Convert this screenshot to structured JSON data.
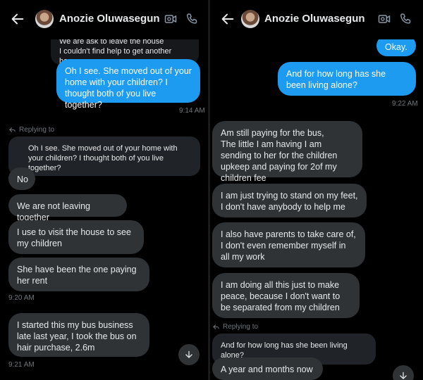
{
  "left": {
    "header": {
      "name": "Anozie Oluwasegun"
    },
    "quoted_top": "We are ask to leave the house\nI couldn't find help to get another house,...",
    "msg_blue": "Oh I see. She moved out of your home with your children? I thought both of you live together?",
    "time1": "9:14 AM",
    "replying_to": "Replying to",
    "quoted_reply": "Oh I see. She moved out of your home with your children? I thought both of you live together?",
    "msg_no": "No",
    "msg_not_leaving": "We are not leaving together",
    "msg_visit": "I use to visit the house to see my children",
    "msg_paying": "She have been the one paying her rent",
    "time2": "9:20 AM",
    "msg_bus": "I started this my bus business late last year, I took the bus on hair purchase, 2.6m",
    "time3": "9:21 AM"
  },
  "right": {
    "header": {
      "name": "Anozie Oluwasegun"
    },
    "msg_okay": "Okay.",
    "msg_how_long": "And for how long has she been living alone?",
    "time1": "9:22 AM",
    "msg_paying_bus": "Am still paying for the bus,\nThe little I am having I am sending to her for the children upkeep and paying for 2of my children fee",
    "msg_trying": "I am just trying to stand on my feet, I don't have anybody to help me",
    "msg_parents": "I also have parents to take care of, I don't even remember myself in all my work",
    "msg_peace": "I am doing all this just to make peace, because I don't want to be separated from my children",
    "replying_to": "Replying to",
    "quoted_reply": "And for how long has she been living alone?",
    "msg_year": "A year and months now"
  },
  "colors": {
    "blue_bubble": "#1d9bf0",
    "gray_bubble": "#2f3336",
    "background": "#000000",
    "muted_text": "#71767b"
  }
}
